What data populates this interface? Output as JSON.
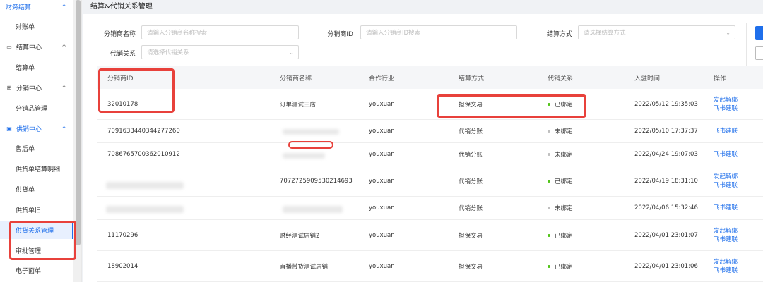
{
  "sidebar": {
    "groups": [
      {
        "label": "财务结算",
        "icon": "finance-icon"
      },
      {
        "label": "结算中心",
        "icon": "settlement-icon"
      },
      {
        "label": "分销中心",
        "icon": "grid-icon"
      },
      {
        "label": "供销中心",
        "icon": "supply-icon"
      }
    ],
    "items": [
      "对账单",
      "结算单",
      "分销品管理",
      "售后单",
      "供货单结算明细",
      "供货单",
      "供货单旧",
      "供货关系管理",
      "审批管理",
      "电子面单"
    ],
    "chevron": "^"
  },
  "page": {
    "title": "结算&代销关系管理"
  },
  "filters": {
    "distributor_name": {
      "label": "分销商名称",
      "placeholder": "请输入分销商名称搜索"
    },
    "distributor_id": {
      "label": "分销商ID",
      "placeholder": "请输入分销商ID搜索"
    },
    "settle_method": {
      "label": "结算方式",
      "placeholder": "请选择结算方式"
    },
    "consign_relation": {
      "label": "代销关系",
      "placeholder": "请选择代销关系"
    }
  },
  "table": {
    "headers": [
      "分销商ID",
      "分销商名称",
      "合作行业",
      "结算方式",
      "代销关系",
      "入驻时间",
      "操作"
    ],
    "rows": [
      {
        "id": "32010178",
        "name": "订单测试三店",
        "industry": "youxuan",
        "method": "担保交易",
        "relation": "已绑定",
        "bound": true,
        "time": "2022/05/12 19:35:03",
        "ops": [
          "发起解绑",
          "飞书建联"
        ]
      },
      {
        "id": "7091633440344277260",
        "name": "",
        "industry": "youxuan",
        "method": "代销分账",
        "relation": "未绑定",
        "bound": false,
        "time": "2022/05/10 17:37:37",
        "ops": [
          "飞书建联"
        ]
      },
      {
        "id": "7086765700362010912",
        "name": "",
        "industry": "youxuan",
        "method": "代销分账",
        "relation": "未绑定",
        "bound": false,
        "time": "2022/04/24 19:07:03",
        "ops": [
          "飞书建联"
        ]
      },
      {
        "id": "",
        "name": "7072725909530214693",
        "industry": "youxuan",
        "method": "代销分账",
        "relation": "已绑定",
        "bound": true,
        "time": "2022/04/19 18:31:10",
        "ops": [
          "发起解绑",
          "飞书建联"
        ]
      },
      {
        "id": "",
        "name": "",
        "industry": "youxuan",
        "method": "代销分账",
        "relation": "未绑定",
        "bound": false,
        "time": "2022/04/06 15:32:46",
        "ops": [
          "飞书建联"
        ]
      },
      {
        "id": "11170296",
        "name": "财经测试店铺2",
        "industry": "youxuan",
        "method": "担保交易",
        "relation": "已绑定",
        "bound": true,
        "time": "2022/04/01 23:01:07",
        "ops": [
          "发起解绑",
          "飞书建联"
        ]
      },
      {
        "id": "18902014",
        "name": "直播带货测试店铺",
        "industry": "youxuan",
        "method": "担保交易",
        "relation": "已绑定",
        "bound": true,
        "time": "2022/04/01 23:01:06",
        "ops": [
          "发起解绑",
          "飞书建联"
        ]
      }
    ]
  },
  "colors": {
    "accent": "#1f6feb",
    "bound_dot": "#52c41a",
    "unbound_dot": "#bfbfbf",
    "highlight": "#e8413b"
  }
}
